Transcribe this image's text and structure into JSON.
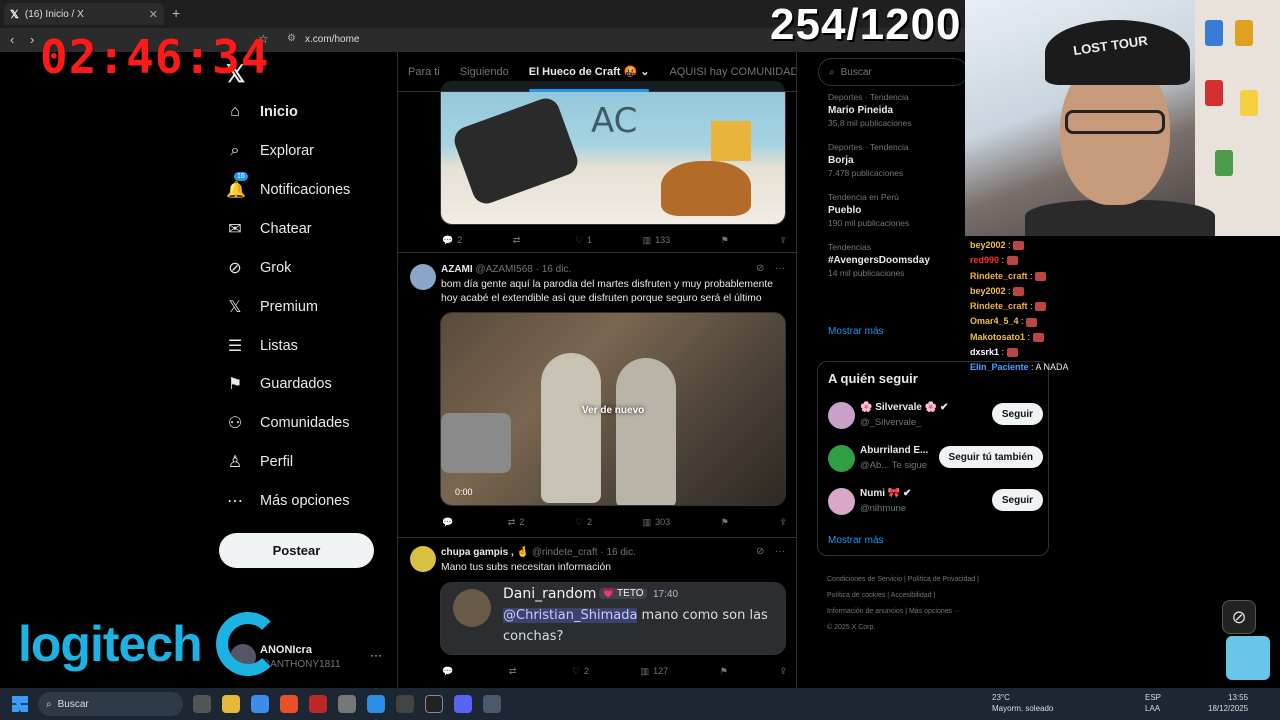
{
  "browser": {
    "tab_title": "(16) Inicio / X",
    "tab_close": "✕",
    "new_tab": "+",
    "url": "x.com/home"
  },
  "overlay": {
    "timer": "02:46:34",
    "counter": "254/1200",
    "cam_cap_text": "LOST TOUR"
  },
  "chat": [
    {
      "user": "bey2002",
      "color": "#f0c040",
      "text": ""
    },
    {
      "user": "red990",
      "color": "#ff3030",
      "text": ""
    },
    {
      "user": "Rindete_craft",
      "color": "#f0b040",
      "text": ""
    },
    {
      "user": "bey2002",
      "color": "#f0c040",
      "text": ""
    },
    {
      "user": "Rindete_craft",
      "color": "#f0b040",
      "text": ""
    },
    {
      "user": "Omar4_5_4",
      "color": "#f0c040",
      "text": ""
    },
    {
      "user": "Makotosato1",
      "color": "#f0c040",
      "text": ""
    },
    {
      "user": "dxsrk1",
      "color": "#ffffff",
      "text": ""
    },
    {
      "user": "Elin_Paciente",
      "color": "#4aa3ff",
      "text": "A NADA"
    }
  ],
  "nav": {
    "logo": "𝕏",
    "items": [
      {
        "label": "Inicio",
        "icon": "home-icon",
        "glyph": "⌂",
        "active": true
      },
      {
        "label": "Explorar",
        "icon": "search-icon",
        "glyph": "⌕"
      },
      {
        "label": "Notificaciones",
        "icon": "bell-icon",
        "glyph": "🔔",
        "badge": "16"
      },
      {
        "label": "Chatear",
        "icon": "mail-icon",
        "glyph": "✉"
      },
      {
        "label": "Grok",
        "icon": "grok-icon",
        "glyph": "⊘"
      },
      {
        "label": "Premium",
        "icon": "x-premium-icon",
        "glyph": "𝕏"
      },
      {
        "label": "Listas",
        "icon": "list-icon",
        "glyph": "☰"
      },
      {
        "label": "Guardados",
        "icon": "bookmark-icon",
        "glyph": "⚑"
      },
      {
        "label": "Comunidades",
        "icon": "communities-icon",
        "glyph": "⚇"
      },
      {
        "label": "Perfil",
        "icon": "profile-icon",
        "glyph": "♙"
      },
      {
        "label": "Más opciones",
        "icon": "more-circle-icon",
        "glyph": "⋯"
      }
    ],
    "post_button": "Postear",
    "account_name": "ANONIcra",
    "account_handle": "@ANTHONY1811",
    "more": "···"
  },
  "brand": {
    "logitech": "logitech"
  },
  "timeline": {
    "tabs": [
      {
        "label": "Para ti"
      },
      {
        "label": "Siguiendo"
      },
      {
        "label": "El Hueco de Craft 🤬 ⌄",
        "active": true
      },
      {
        "label": "AQUISI hay COMUNIDAD"
      }
    ],
    "tweet1": {
      "replies": "2",
      "retweets": "",
      "likes": "1",
      "views": "133",
      "image_text": "AC"
    },
    "tweet2": {
      "name": "AZAMI",
      "handle": "@AZAMI568",
      "date": "· 16 dic.",
      "text": "bom día gente aquí la parodia del martes disfruten y muy probablemente hoy acabé el extendible así que disfruten porque seguro será el último",
      "video_label": "Ver de nuevo",
      "video_time": "0:00",
      "replies": "",
      "retweets": "2",
      "likes": "2",
      "views": "303"
    },
    "tweet3": {
      "name": "chupa gampis , 🤞",
      "handle": "@rindete_craft",
      "date": "· 16 dic.",
      "text": "Mano tus subs necesitan información",
      "embed_name": "Dani_random",
      "embed_tag": "💗 TETO",
      "embed_time": "17:40",
      "embed_mention": "@Christian_Shimada",
      "embed_text": " mano como son las conchas?",
      "replies": "",
      "retweets": "",
      "likes": "2",
      "views": "127"
    }
  },
  "right": {
    "search_placeholder": "Buscar",
    "trends": [
      {
        "category": "Deportes · Tendencia",
        "name": "Mario Pineida",
        "count": "35,8 mil publicaciones"
      },
      {
        "category": "Deportes · Tendencia",
        "name": "Borja",
        "count": "7.478 publicaciones"
      },
      {
        "category": "Tendencia en Perú",
        "name": "Pueblo",
        "count": "190 mil publicaciones"
      },
      {
        "category": "Tendencias",
        "name": "#AvengersDoomsday",
        "count": "14 mil publicaciones"
      }
    ],
    "show_more": "Mostrar más",
    "who_title": "A quién seguir",
    "who": [
      {
        "name": "🌸 Silvervale 🌸 ✔",
        "handle": "@_Silvervale_",
        "button": "Seguir",
        "color": "#c9a0c8"
      },
      {
        "name": "Aburriland E...",
        "handle": "@Ab...  Te sigue",
        "button": "Seguir tú también",
        "color": "#2f9e44"
      },
      {
        "name": "Numi 🎀 ✔",
        "handle": "@nihmune",
        "button": "Seguir",
        "color": "#d9a8c8"
      }
    ],
    "who_more": "Mostrar más",
    "footer": [
      "Condiciones de Servicio  |  Política de Privacidad  |",
      "Política de cookies  |  Accesibilidad  |",
      "Información de anuncios  |  Más opciones ···",
      "© 2025 X Corp."
    ]
  },
  "taskbar": {
    "search": "Buscar",
    "weather_temp": "23°C",
    "weather_desc": "Mayorm. soleado",
    "lang1": "ESP",
    "lang2": "LAA",
    "time": "13:55",
    "date": "18/12/2025"
  }
}
